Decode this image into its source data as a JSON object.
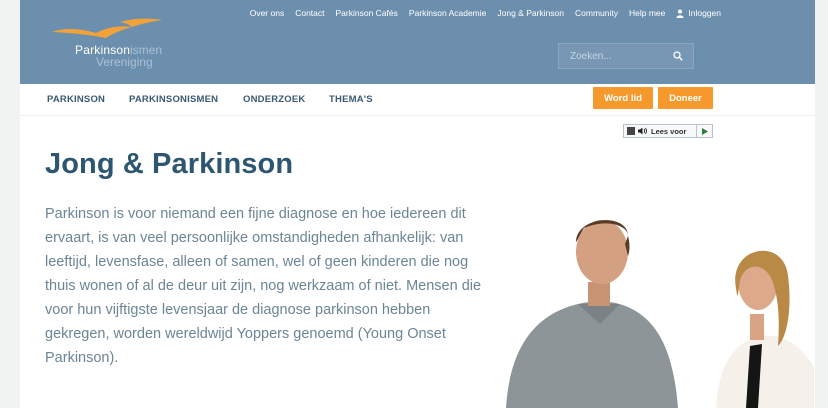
{
  "top_nav": {
    "links": [
      "Over ons",
      "Contact",
      "Parkinson Cafés",
      "Parkinson Academie",
      "Jong & Parkinson",
      "Community",
      "Help mee"
    ],
    "login_label": "Inloggen"
  },
  "logo": {
    "line1": "Parkinson",
    "line1_suffix": "ismen",
    "line2": "Vereniging"
  },
  "search": {
    "placeholder": "Zoeken..."
  },
  "main_nav": {
    "items": [
      "PARKINSON",
      "PARKINSONISMEN",
      "ONDERZOEK",
      "THEMA'S"
    ],
    "member_button": "Word lid",
    "donate_button": "Doneer"
  },
  "readspeaker": {
    "label": "Lees voor"
  },
  "page": {
    "title": "Jong & Parkinson",
    "intro": "Parkinson is voor niemand een fijne diagnose en hoe iedereen dit ervaart, is van veel persoonlijke omstandigheden afhankelijk: van leeftijd, levensfase, alleen of samen, wel of geen kinderen die nog thuis wonen of al de deur uit zijn, nog werkzaam of niet. Mensen die voor hun vijftigste levensjaar de diagnose parkinson hebben gekregen, worden wereldwijd Yoppers genoemd (Young Onset Parkinson)."
  },
  "colors": {
    "header_bg": "#6d8fae",
    "accent_orange": "#f6992d",
    "title_color": "#2d5670",
    "body_text": "#6c8594",
    "nav_text": "#3a5a72"
  },
  "icons": {
    "search": "search-icon",
    "user": "user-icon",
    "speaker": "speaker-icon",
    "play": "play-icon",
    "logo_birds": "bird-logo-icon"
  }
}
